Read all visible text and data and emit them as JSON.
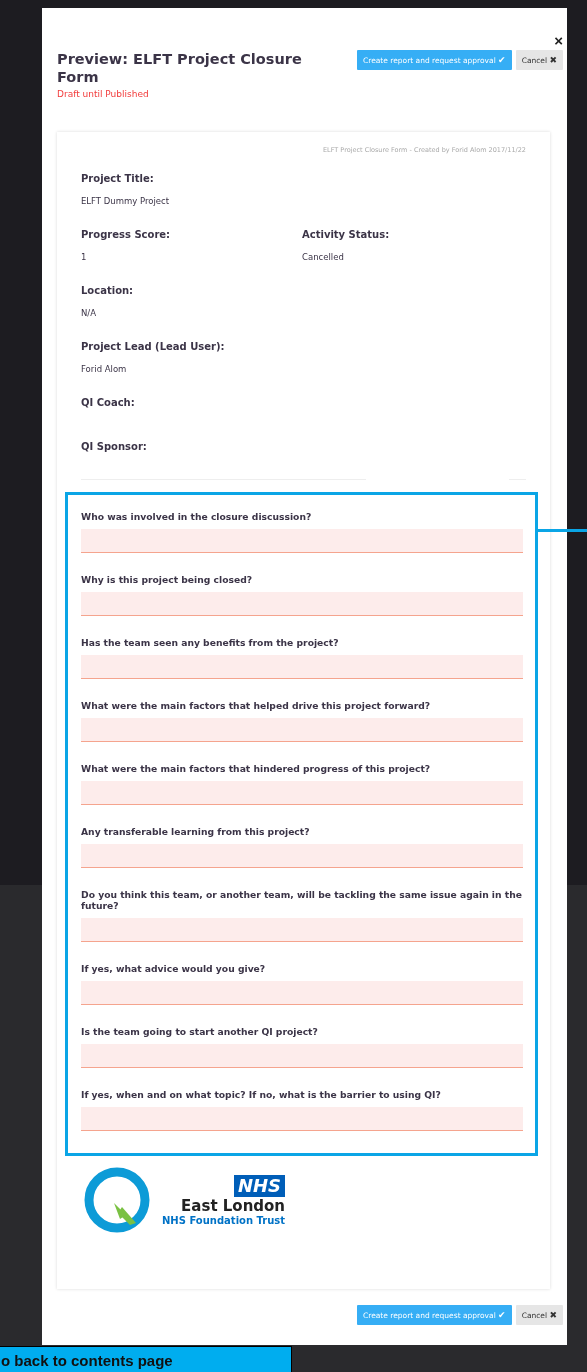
{
  "modal": {
    "close": "×",
    "title": "Preview: ELFT Project Closure Form",
    "status": "Draft until Published"
  },
  "actions_top": [
    {
      "kind": "primary",
      "label": "Create report and request approval",
      "icon": "✔"
    },
    {
      "kind": "secondary",
      "label": "Cancel",
      "icon": "✖"
    }
  ],
  "card": {
    "meta": "ELFT Project Closure Form - Created by Forid Alom 2017/11/22",
    "rows": [
      [
        {
          "label": "Project Title:",
          "value": "ELFT Dummy Project"
        }
      ],
      [
        {
          "label": "Progress Score:",
          "value": "1"
        },
        {
          "label": "Activity Status:",
          "value": "Cancelled"
        }
      ],
      [
        {
          "label": "Location:",
          "value": "N/A"
        }
      ],
      [
        {
          "label": "Project Lead (Lead User):",
          "value": "Forid Alom"
        }
      ],
      [
        {
          "label": "QI Coach:"
        }
      ],
      [
        {
          "label": "QI Sponsor:"
        }
      ]
    ],
    "questions": [
      {
        "label": "Who was involved in the closure discussion?"
      },
      {
        "label": "Why is this project being closed?"
      },
      {
        "label": "Has the team seen any benefits from the project?"
      },
      {
        "label": "What were the main factors that helped drive this project forward?"
      },
      {
        "label": "What were the main factors that hindered progress of this project?"
      },
      {
        "label": "Any transferable learning from this project?"
      },
      {
        "label": "Do you think this team, or another team, will be tackling the same issue again in the future?"
      },
      {
        "label": "If yes, what advice would you give?"
      },
      {
        "label": "Is the team going to start another QI project?"
      },
      {
        "label": "If yes, when and on what topic? If no, what is the barrier to using QI?"
      }
    ],
    "logo": {
      "badge": "NHS",
      "name": "East London",
      "trust": "NHS Foundation Trust"
    }
  },
  "actions_bottom": [
    {
      "kind": "primary",
      "label": "Create report and request approval",
      "icon": "✔"
    },
    {
      "kind": "secondary",
      "label": "Cancel",
      "icon": "✖"
    }
  ],
  "callout": "o back to contents page"
}
